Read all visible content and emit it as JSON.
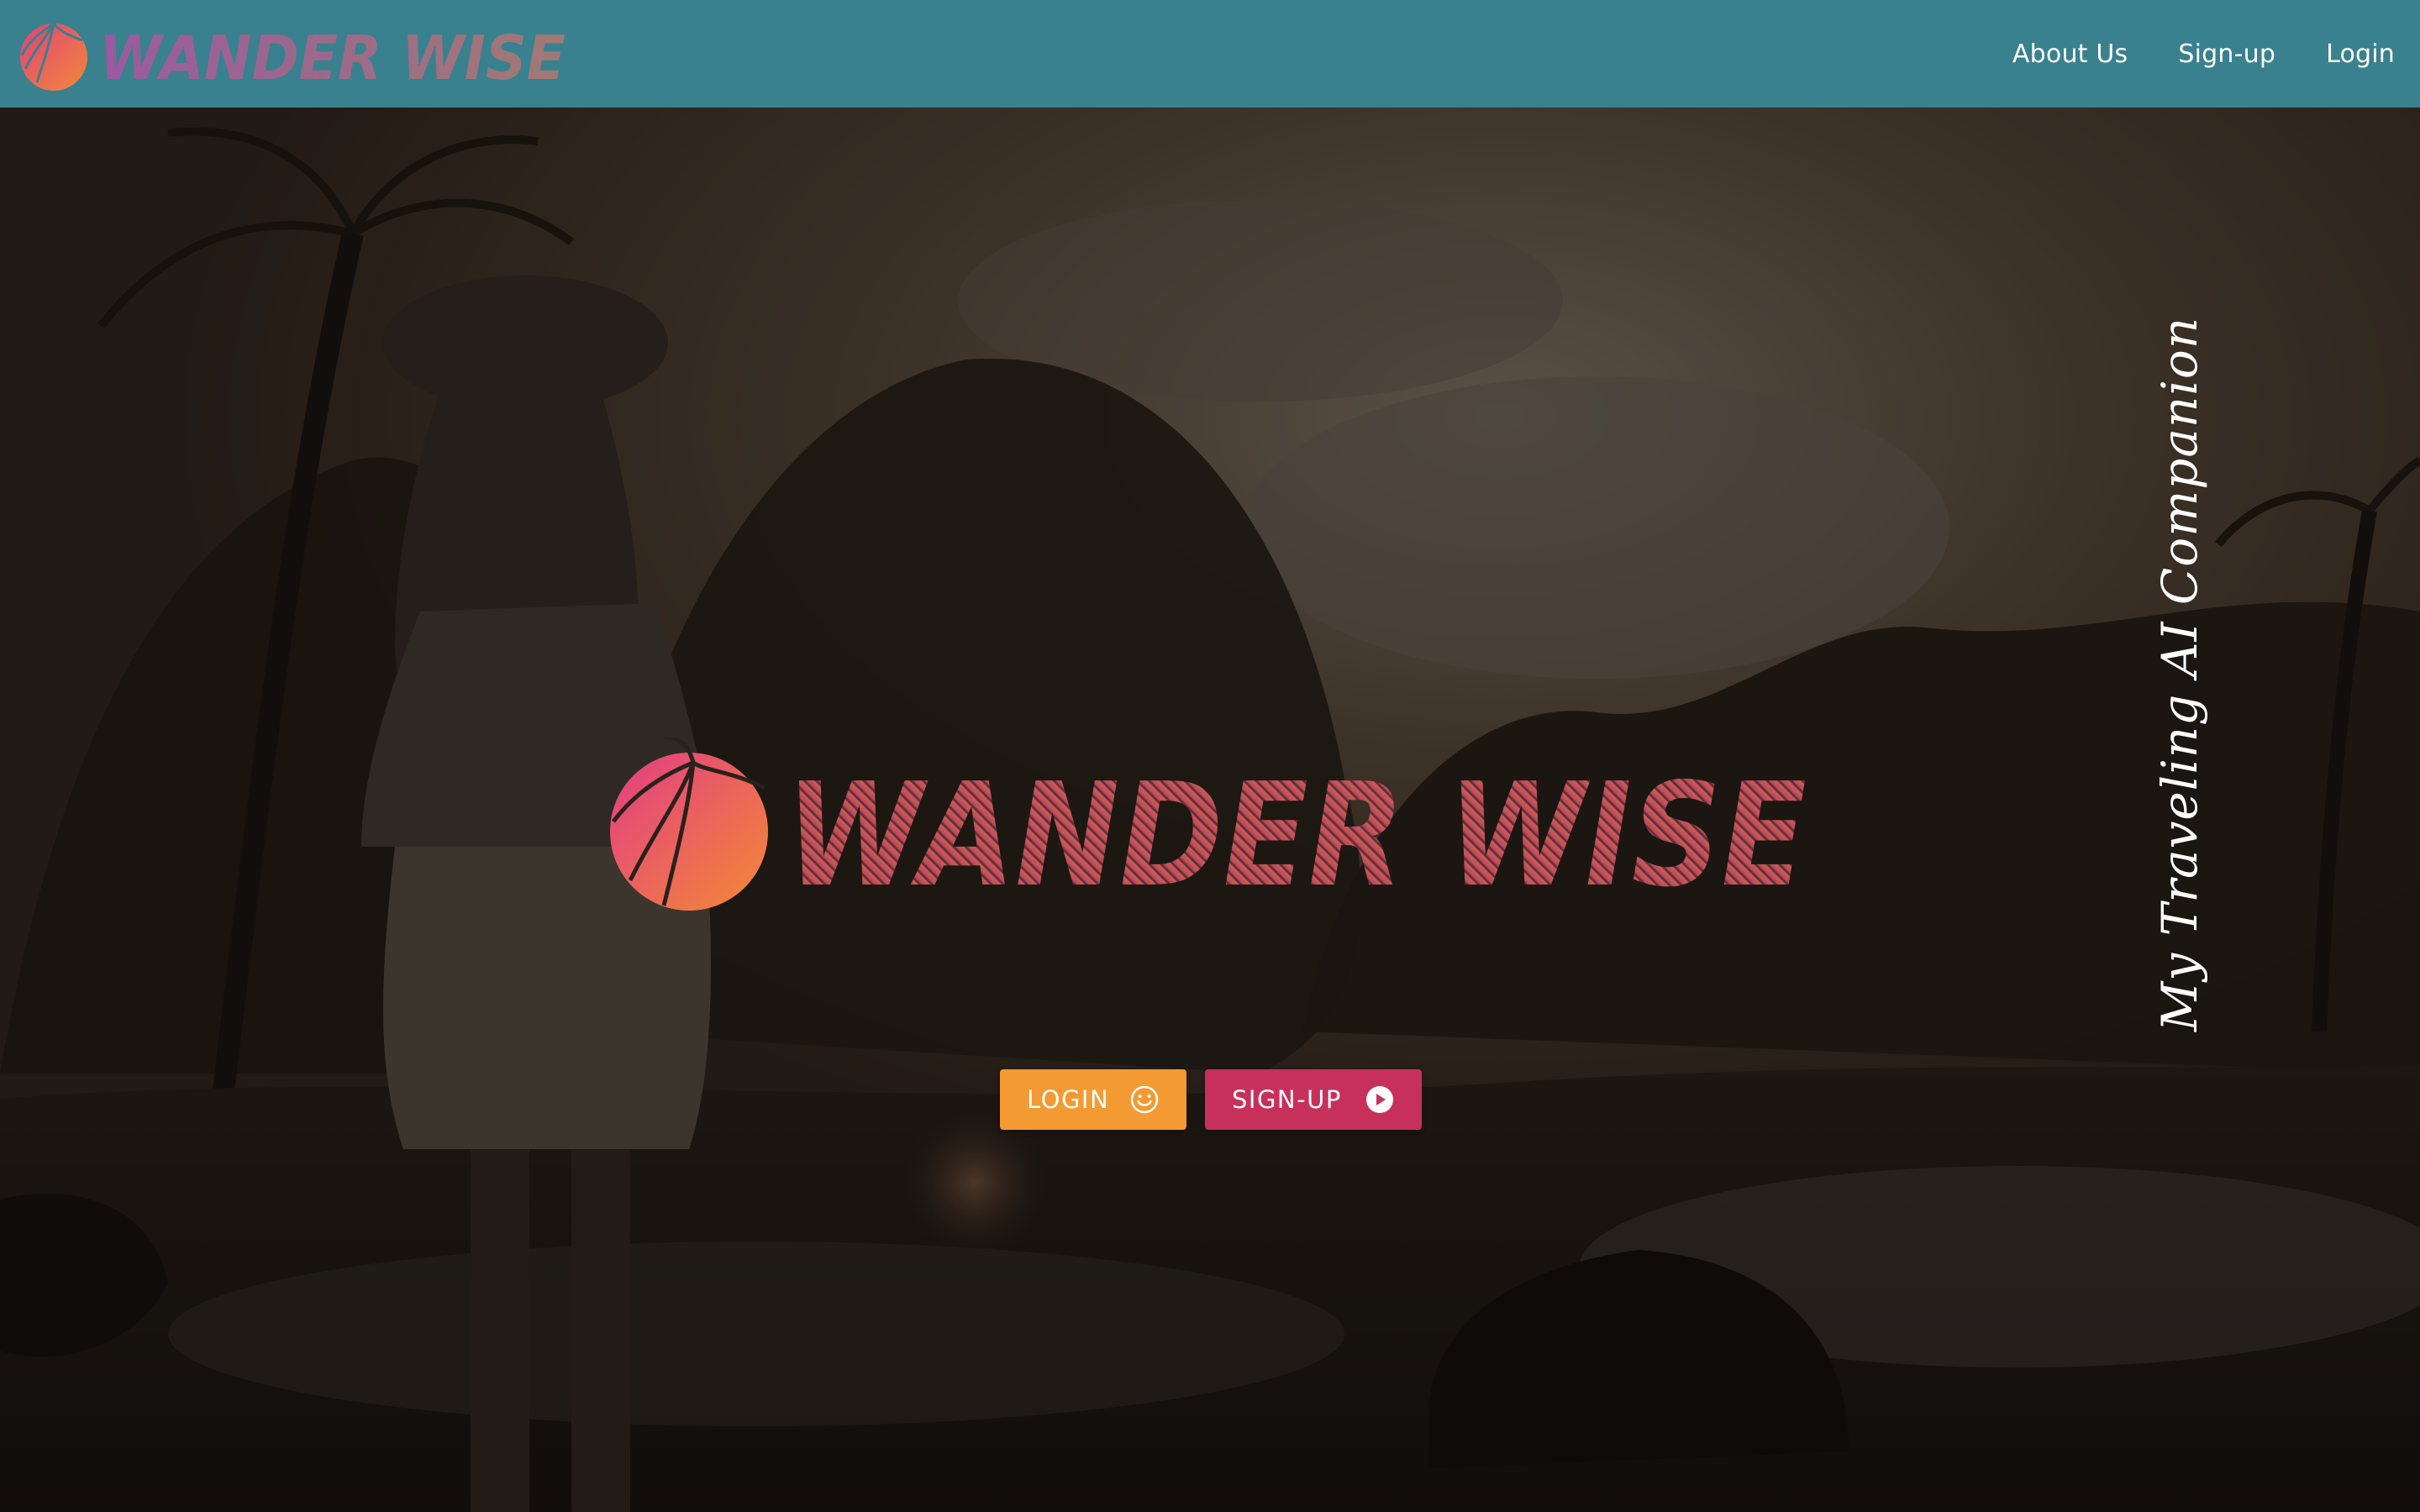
{
  "brand": {
    "name": "WANDER WISE",
    "colors": {
      "navbar": "#39818e",
      "logo_gradient_start": "#e0417a",
      "logo_gradient_end": "#f08a3c",
      "login_button": "#f39a32",
      "signup_button": "#c8305c"
    }
  },
  "nav": {
    "links": [
      {
        "label": "About Us"
      },
      {
        "label": "Sign-up"
      },
      {
        "label": "Login"
      }
    ]
  },
  "hero": {
    "login_button": {
      "label": "LOGIN",
      "icon": "smiley-icon"
    },
    "signup_button": {
      "label": "SIGN-UP",
      "icon": "play-circle-icon"
    },
    "tagline": "My Traveling AI Companion",
    "background_icon": "sunset-beach-photo"
  }
}
